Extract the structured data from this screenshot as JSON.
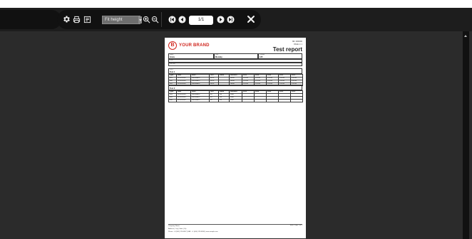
{
  "toolbar": {
    "settings_icon": "gear-icon",
    "print_icon": "printer-icon",
    "export_icon": "export-icon",
    "zoom_mode": "Fit height",
    "zoom_in_icon": "zoom-in-icon",
    "zoom_out_icon": "zoom-out-icon",
    "page_indicator": "1/1",
    "close_icon": "close-icon"
  },
  "report": {
    "logo_letter": "B",
    "brand": "YOUR BRAND",
    "doc_no_line": "NR. 0000000",
    "version_line": "PAGE 1 / 1",
    "title": "Test report",
    "fields": [
      {
        "label": "Name",
        "value": "Greta"
      },
      {
        "label": "Date",
        "value": "Monday"
      },
      {
        "label": "Position",
        "value": "125"
      }
    ],
    "subfields": [
      {
        "label": "Plant",
        "value": ""
      },
      {
        "label": "Pre-Text",
        "value": ""
      }
    ],
    "sections": [
      {
        "label": "Test 1",
        "value": "Test 1",
        "columns": [
          "Type",
          "Date",
          "Desc.",
          "Unit",
          "Value",
          "Remarks",
          "20x1",
          "20x2",
          "20x3",
          "20x4",
          "20x5"
        ],
        "rows": [
          [
            "201",
            "10.06.2024",
            "Lubrication",
            "WOF",
            "",
            "Good",
            "0.1311",
            "0.1311",
            "0.1311",
            "0.1311",
            "0.1311"
          ],
          [
            "202",
            "10.06.2024",
            "Lubrication",
            "WOF",
            "",
            "Good",
            "0.1311",
            "0.1311",
            "0.1311",
            "0.1311",
            "0.1311"
          ],
          [
            "203",
            "10.06.2024",
            "Lubrication",
            "WOF",
            "",
            "Good",
            "0.1311",
            "0.1311",
            "0.1311",
            "0.1311",
            "0.1311"
          ]
        ]
      },
      {
        "label": "Test 2",
        "value": "Test 2",
        "columns": [
          "Type",
          "Date",
          "Desc.",
          "Unit",
          "Value",
          "Remarks",
          "20x1",
          "20x2",
          "20x3",
          "20x4",
          "20x5"
        ],
        "rows": [
          [
            "304",
            "10.06.2024",
            "Lubrication",
            "Zn",
            "Ok",
            "Paid",
            "",
            "",
            "",
            "",
            ""
          ],
          [
            "305",
            "10.06.2024",
            "Lubrication",
            "Zn",
            "Ok",
            "Paid",
            "",
            "",
            "",
            "",
            ""
          ],
          [
            "306",
            "10.06.2024",
            "Lubrication",
            "Zn",
            "Ok",
            "Paid",
            "",
            "",
            "",
            "",
            ""
          ]
        ]
      }
    ],
    "footer": {
      "company": "Company Name",
      "address": "Address | City | State | Zip",
      "contact": "Phone: +1 (000) 123-4567 | FAX: +1 (000) 123-4568 | www.sample.com",
      "page": "Seite: Page 1 of 1"
    }
  }
}
